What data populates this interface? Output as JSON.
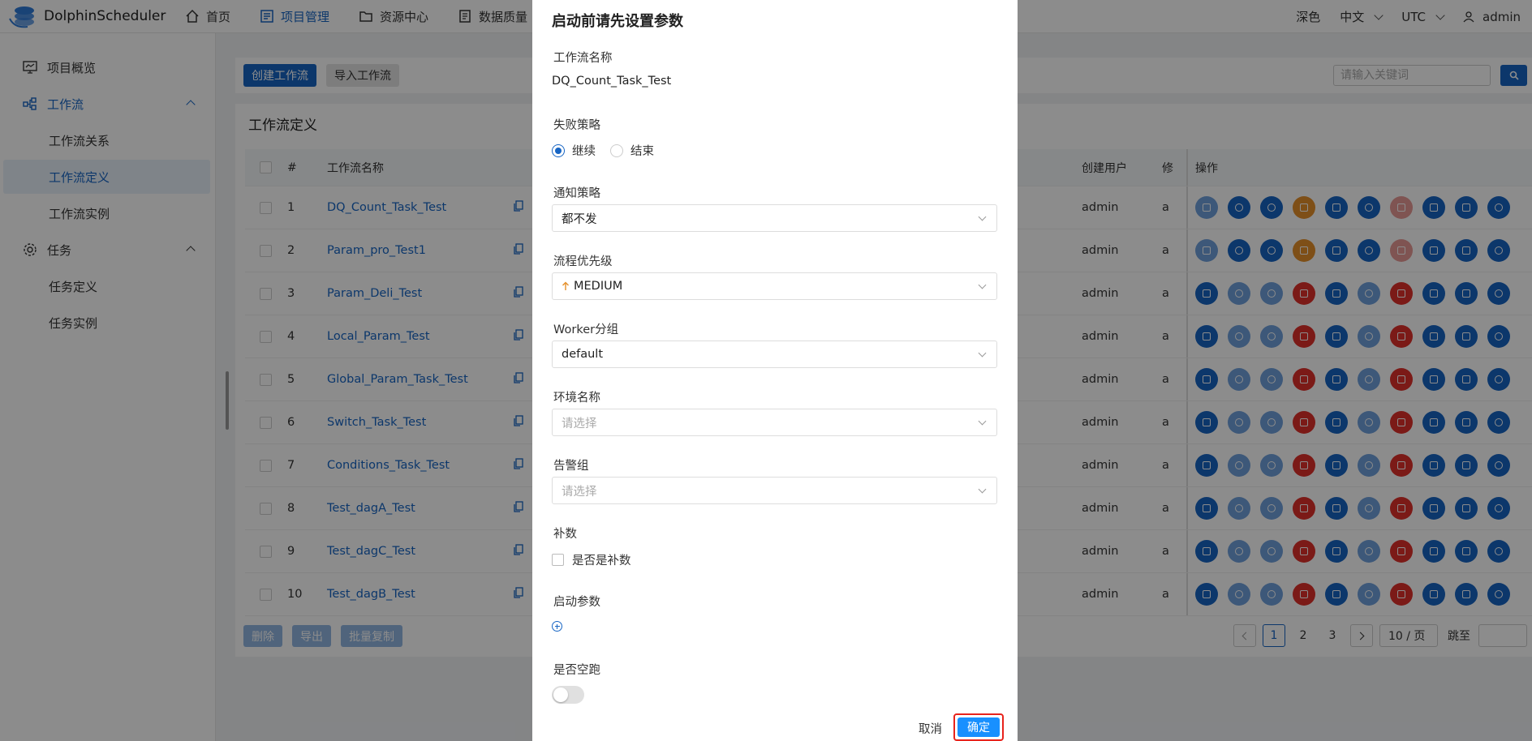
{
  "header": {
    "brand": "DolphinScheduler",
    "nav": [
      {
        "label": "首页"
      },
      {
        "label": "项目管理"
      },
      {
        "label": "资源中心"
      },
      {
        "label": "数据质量"
      }
    ],
    "theme": "深色",
    "language": "中文",
    "timezone": "UTC",
    "user": "admin"
  },
  "sidebar": {
    "items": [
      {
        "label": "项目概览"
      },
      {
        "label": "工作流"
      },
      {
        "label": "工作流关系"
      },
      {
        "label": "工作流定义"
      },
      {
        "label": "工作流实例"
      },
      {
        "label": "任务"
      },
      {
        "label": "任务定义"
      },
      {
        "label": "任务实例"
      }
    ]
  },
  "toolbar": {
    "create_label": "创建工作流",
    "import_label": "导入工作流",
    "search_placeholder": "请输入关键词"
  },
  "card": {
    "title": "工作流定义",
    "columns": {
      "num": "#",
      "name": "工作流名称",
      "user": "创建用户",
      "mod": "修",
      "ops": "操作"
    },
    "rows": [
      {
        "num": "1",
        "name": "DQ_Count_Task_Test",
        "user": "admin",
        "mod": "a"
      },
      {
        "num": "2",
        "name": "Param_pro_Test1",
        "user": "admin",
        "mod": "a"
      },
      {
        "num": "3",
        "name": "Param_Deli_Test",
        "user": "admin",
        "mod": "a"
      },
      {
        "num": "4",
        "name": "Local_Param_Test",
        "user": "admin",
        "mod": "a"
      },
      {
        "num": "5",
        "name": "Global_Param_Task_Test",
        "user": "admin",
        "mod": "a"
      },
      {
        "num": "6",
        "name": "Switch_Task_Test",
        "user": "admin",
        "mod": "a"
      },
      {
        "num": "7",
        "name": "Conditions_Task_Test",
        "user": "admin",
        "mod": "a"
      },
      {
        "num": "8",
        "name": "Test_dagA_Test",
        "user": "admin",
        "mod": "a"
      },
      {
        "num": "9",
        "name": "Test_dagC_Test",
        "user": "admin",
        "mod": "a"
      },
      {
        "num": "10",
        "name": "Test_dagB_Test",
        "user": "admin",
        "mod": "a"
      }
    ],
    "footer": {
      "delete": "删除",
      "export": "导出",
      "batch_copy": "批量复制"
    },
    "pager": {
      "p1": "1",
      "p2": "2",
      "p3": "3",
      "size": "10 / 页",
      "jump": "跳至"
    }
  },
  "modal": {
    "title": "启动前请先设置参数",
    "name_label": "工作流名称",
    "name_value": "DQ_Count_Task_Test",
    "failure_label": "失败策略",
    "failure_continue": "继续",
    "failure_end": "结束",
    "notify_label": "通知策略",
    "notify_value": "都不发",
    "priority_label": "流程优先级",
    "priority_value": "MEDIUM",
    "worker_label": "Worker分组",
    "worker_value": "default",
    "env_label": "环境名称",
    "env_placeholder": "请选择",
    "alert_label": "告警组",
    "alert_placeholder": "请选择",
    "complement_label": "补数",
    "complement_check": "是否是补数",
    "params_label": "启动参数",
    "dryrun_label": "是否空跑",
    "cancel": "取消",
    "ok": "确定"
  },
  "colors": {
    "primary": "#1765c4",
    "danger": "#e0302a",
    "warning": "#e5902a",
    "highlight": "#e8231c"
  }
}
